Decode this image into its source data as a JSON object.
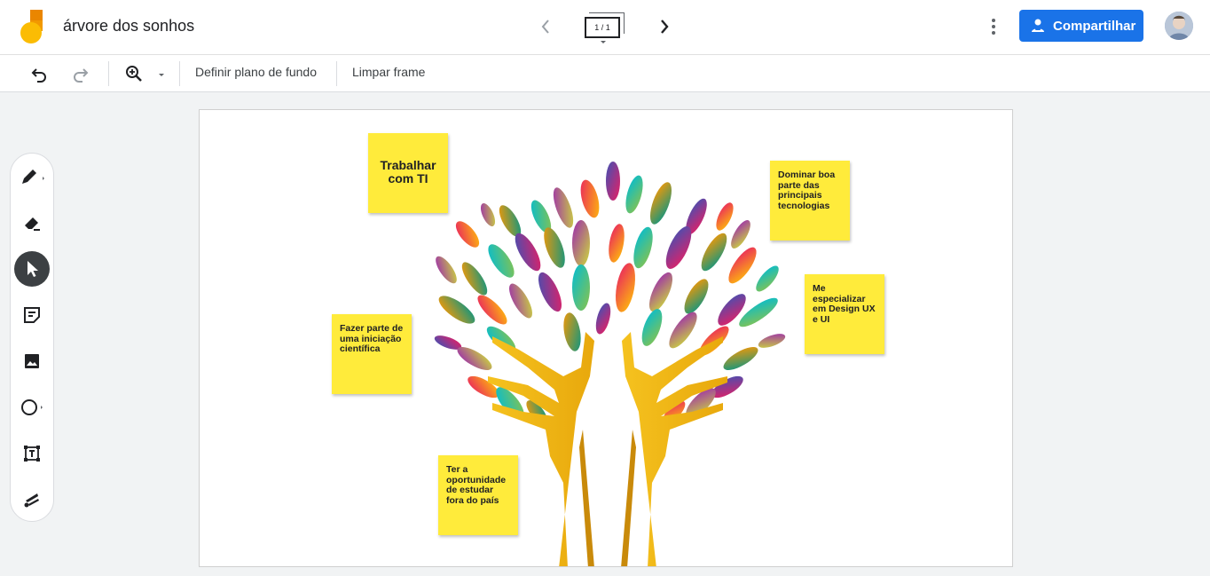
{
  "header": {
    "title": "árvore dos sonhos",
    "frame_indicator": "1 / 1",
    "share_label": "Compartilhar"
  },
  "toolbar": {
    "set_background_label": "Definir plano de fundo",
    "clear_frame_label": "Limpar frame"
  },
  "side_tools": [
    {
      "icon": "pen-icon"
    },
    {
      "icon": "eraser-icon"
    },
    {
      "icon": "select-arrow-icon",
      "active": true
    },
    {
      "icon": "sticky-note-icon"
    },
    {
      "icon": "image-icon"
    },
    {
      "icon": "circle-shape-icon"
    },
    {
      "icon": "text-box-icon"
    },
    {
      "icon": "laser-icon"
    }
  ],
  "notes": {
    "note1": "Trabalhar com TI",
    "note2": "Dominar boa parte das principais tecnologias",
    "note3": "Me especializar em Design UX e UI",
    "note4": "Fazer parte de uma iniciação científica",
    "note5": "Ter a oportunidade de estudar fora do país"
  },
  "colors": {
    "accent": "#1a73e8",
    "note": "#ffeb3b",
    "trunk": "#f0b41c"
  }
}
